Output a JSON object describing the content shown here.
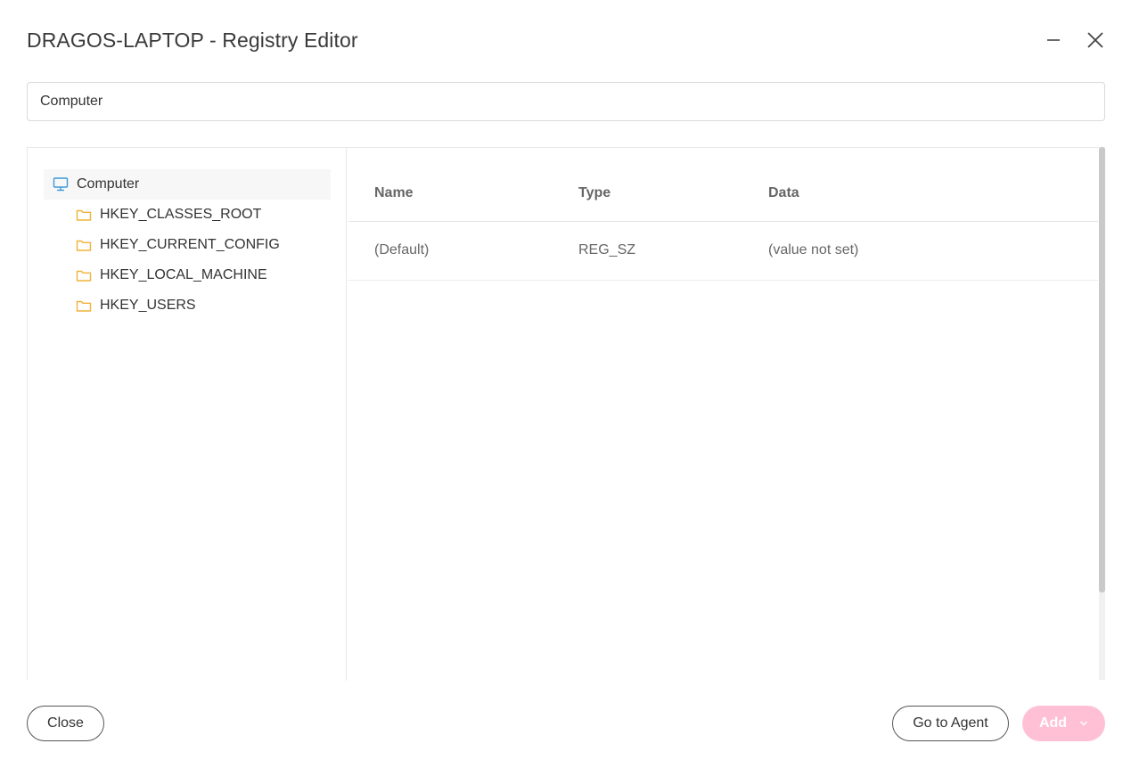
{
  "window": {
    "title": "DRAGOS-LAPTOP - Registry Editor"
  },
  "path_input": {
    "value": "Computer"
  },
  "tree": {
    "root_label": "Computer",
    "children": [
      {
        "label": "HKEY_CLASSES_ROOT"
      },
      {
        "label": "HKEY_CURRENT_CONFIG"
      },
      {
        "label": "HKEY_LOCAL_MACHINE"
      },
      {
        "label": "HKEY_USERS"
      }
    ]
  },
  "table": {
    "columns": [
      "Name",
      "Type",
      "Data"
    ],
    "rows": [
      {
        "name": "(Default)",
        "type": "REG_SZ",
        "data": "(value not set)"
      }
    ]
  },
  "footer": {
    "close_label": "Close",
    "go_to_agent_label": "Go to Agent",
    "add_label": "Add"
  },
  "colors": {
    "accent_pink": "#ffc0d6",
    "folder_icon": "#f0b23a",
    "computer_icon": "#3a9ad9"
  }
}
